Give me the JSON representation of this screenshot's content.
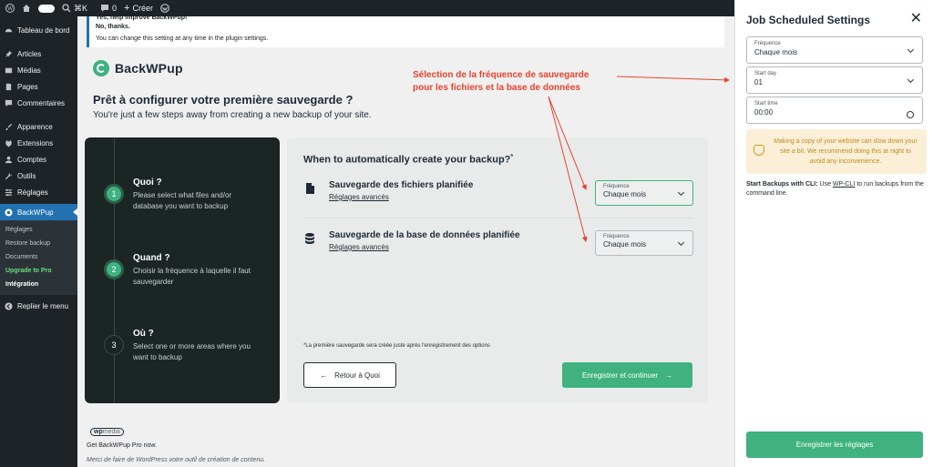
{
  "adminbar": {
    "shortcut": "⌘K",
    "comments_count": "0",
    "new_label": "Créer"
  },
  "sidebar": {
    "items": [
      {
        "label": "Tableau de bord",
        "icon": "dashboard-icon"
      },
      {
        "label": "Articles",
        "icon": "pin-icon"
      },
      {
        "label": "Médias",
        "icon": "media-icon"
      },
      {
        "label": "Pages",
        "icon": "page-icon"
      },
      {
        "label": "Commentaires",
        "icon": "comment-icon"
      },
      {
        "label": "Apparence",
        "icon": "brush-icon"
      },
      {
        "label": "Extensions",
        "icon": "plugin-icon"
      },
      {
        "label": "Comptes",
        "icon": "user-icon"
      },
      {
        "label": "Outils",
        "icon": "wrench-icon"
      },
      {
        "label": "Réglages",
        "icon": "settings-icon"
      }
    ],
    "active": {
      "label": "BackWPup",
      "icon": "backwpup-icon"
    },
    "submenu": [
      "Réglages",
      "Restore backup",
      "Documents",
      "Upgrade to Pro",
      "Intégration"
    ],
    "collapse": "Replier le menu"
  },
  "notice": {
    "line1": "Yes, help improve BackWPup!",
    "line2": "No, thanks.",
    "line3": "You can change this setting at any time in the plugin settings."
  },
  "brand": "BackWPup",
  "header": {
    "title": "Prêt à configurer votre première sauvegarde ?",
    "subtitle": "You're just a few steps away from creating a new backup of your site."
  },
  "steps": [
    {
      "num": "1",
      "title": "Quoi ?",
      "desc": "Please select what files and/or database you want to backup"
    },
    {
      "num": "2",
      "title": "Quand ?",
      "desc": "Choisir la fréquence à laquelle il faut sauvegarder"
    },
    {
      "num": "3",
      "title": "Où ?",
      "desc": "Select one or more areas where you want to backup"
    }
  ],
  "panel": {
    "heading": "When to automatically create your backup?",
    "heading_mark": "*",
    "rows": [
      {
        "title": "Sauvegarde des fichiers planifiée",
        "link": "Réglages avancés",
        "select_label": "Fréquence",
        "select_value": "Chaque mois"
      },
      {
        "title": "Sauvegarde de la base de données planifiée",
        "link": "Réglages avancés",
        "select_label": "Fréquence",
        "select_value": "Chaque mois"
      }
    ],
    "footnote": "*La première sauvegarde sera créée juste après l'enregistrement des options",
    "back_label": "Retour à Quoi",
    "next_label": "Enregistrer et continuer"
  },
  "annotation": {
    "line1": "Sélection de la fréquence de sauvegarde",
    "line2": "pour les fichiers et la base de données",
    "color": "#e8432c"
  },
  "footer": {
    "logo_a": "wp",
    "logo_b": "media",
    "line1": "Get BackWPup Pro now.",
    "line2": "Merci de faire de WordPress votre outil de création de contenu."
  },
  "drawer": {
    "title": "Job Scheduled Settings",
    "close": "✕",
    "fields": [
      {
        "label": "Fréquence",
        "value": "Chaque mois"
      },
      {
        "label": "Start day",
        "value": "01"
      },
      {
        "label": "Start time",
        "value": "00:00"
      }
    ],
    "warning": "Making a copy of your website can slow down your site a bit. We recommend doing this at night to avoid any inconvenience.",
    "cli_bold": "Start Backups with CLI:",
    "cli_pre": " Use ",
    "cli_link": "WP-CLI",
    "cli_post": " to run backups from the command line.",
    "save_label": "Enregistrer les réglages"
  },
  "colors": {
    "accent": "#3fb27f",
    "wp_dark": "#1d2327",
    "wp_blue": "#2271b1",
    "warning_bg": "#fcefd7"
  }
}
